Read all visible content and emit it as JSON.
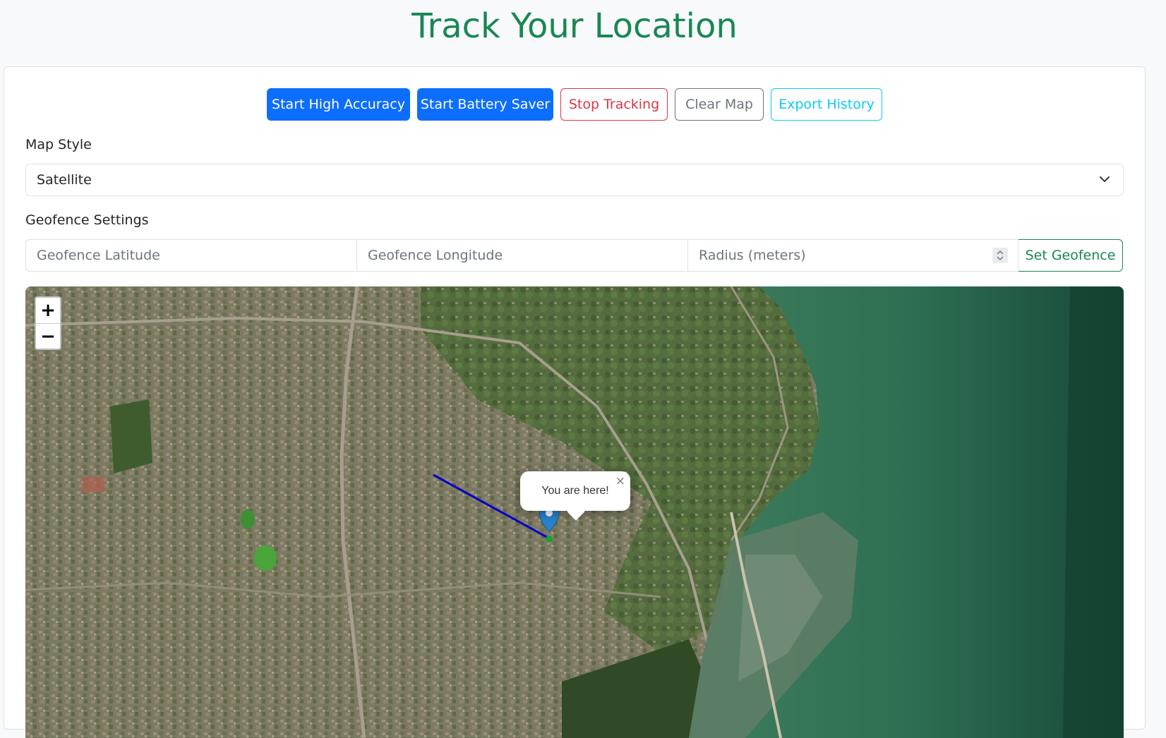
{
  "page": {
    "title": "Track Your Location"
  },
  "toolbar": {
    "start_high_accuracy": "Start High Accuracy",
    "start_battery_saver": "Start Battery Saver",
    "stop_tracking": "Stop Tracking",
    "clear_map": "Clear Map",
    "export_history": "Export History"
  },
  "map_style": {
    "label": "Map Style",
    "selected": "Satellite"
  },
  "geofence": {
    "label": "Geofence Settings",
    "latitude_placeholder": "Geofence Latitude",
    "longitude_placeholder": "Geofence Longitude",
    "radius_placeholder": "Radius (meters)",
    "set_button": "Set Geofence"
  },
  "map": {
    "zoom_in": "+",
    "zoom_out": "−",
    "popup_text": "You are here!",
    "popup_close": "×",
    "track_color": "#0000cc",
    "marker_color": "#2a81cb"
  },
  "colors": {
    "title_green": "#198754",
    "primary": "#0d6efd",
    "danger": "#dc3545",
    "secondary": "#6c757d",
    "info": "#0dcaf0"
  }
}
